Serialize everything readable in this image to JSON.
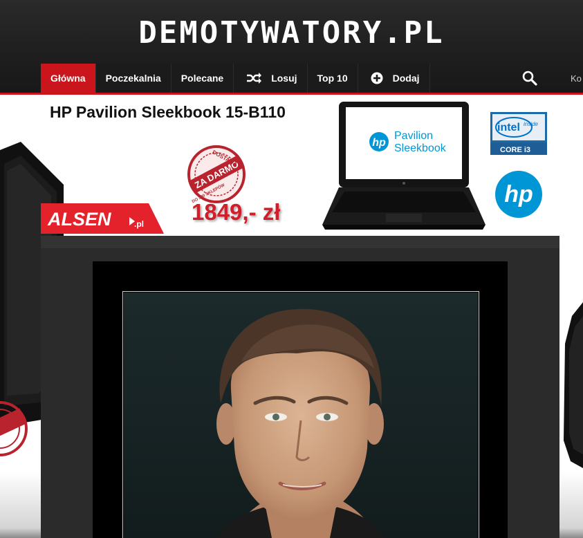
{
  "header": {
    "logo": "DEMOTYWATORY.PL",
    "login_partial": "Ko"
  },
  "nav": [
    {
      "label": "Główna",
      "active": true
    },
    {
      "label": "Poczekalnia"
    },
    {
      "label": "Polecane"
    },
    {
      "label": "Losuj",
      "icon": "shuffle-icon"
    },
    {
      "label": "Top 10"
    },
    {
      "label": "Dodaj",
      "icon": "plus-circle-icon"
    }
  ],
  "banner": {
    "title": "HP Pavilion Sleekbook 15-B110",
    "stamp_lines": [
      "DOSTAWA",
      "ZA DARMO",
      "DO 300 SKLEPÓW"
    ],
    "price": "1849,- zł",
    "store_logo": "ALSEN",
    "store_logo_suffix": ".pl",
    "laptop_screen_brand": "Pavilion",
    "laptop_screen_model": "Sleekbook",
    "intel_badge_top": "intel",
    "intel_badge_inside": "inside",
    "intel_badge_bottom": "CORE i3",
    "hp_logo": "hp"
  },
  "colors": {
    "accent": "#c9151b",
    "header_bg": "#1e1e1e",
    "content_bg": "#2b2b2b",
    "price": "#d21d2a",
    "hp_blue": "#0096d6"
  },
  "icons": {
    "search": "search-icon",
    "shuffle": "shuffle-icon",
    "add": "plus-circle-icon"
  }
}
